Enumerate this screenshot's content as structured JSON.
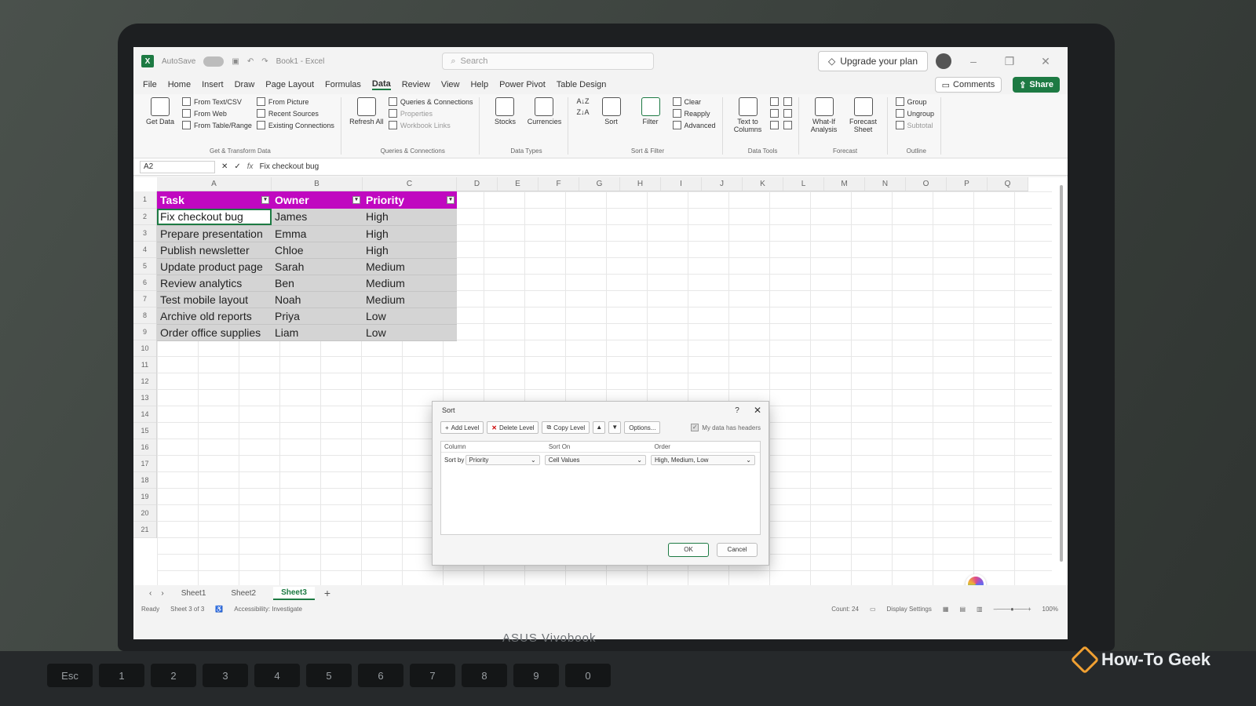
{
  "titlebar": {
    "autosave_label": "AutoSave",
    "doc_title": "Book1 - Excel",
    "search_placeholder": "Search",
    "upgrade_label": "Upgrade your plan"
  },
  "menu": {
    "items": [
      "File",
      "Home",
      "Insert",
      "Draw",
      "Page Layout",
      "Formulas",
      "Data",
      "Review",
      "View",
      "Help",
      "Power Pivot",
      "Table Design"
    ],
    "active": "Data",
    "comments_label": "Comments",
    "share_label": "Share"
  },
  "ribbon": {
    "get_data": "Get Data",
    "from_text_csv": "From Text/CSV",
    "from_web": "From Web",
    "from_table_range": "From Table/Range",
    "from_picture": "From Picture",
    "recent_sources": "Recent Sources",
    "existing_connections": "Existing Connections",
    "group_get_transform": "Get & Transform Data",
    "refresh_all": "Refresh All",
    "queries_connections": "Queries & Connections",
    "properties": "Properties",
    "workbook_links": "Workbook Links",
    "group_queries": "Queries & Connections",
    "stocks": "Stocks",
    "currencies": "Currencies",
    "group_data_types": "Data Types",
    "sort": "Sort",
    "filter": "Filter",
    "clear": "Clear",
    "reapply": "Reapply",
    "advanced": "Advanced",
    "group_sort_filter": "Sort & Filter",
    "text_to_columns": "Text to Columns",
    "group_data_tools": "Data Tools",
    "what_if": "What-If Analysis",
    "forecast_sheet": "Forecast Sheet",
    "group_forecast": "Forecast",
    "group": "Group",
    "ungroup": "Ungroup",
    "subtotal": "Subtotal",
    "group_outline": "Outline"
  },
  "formula_bar": {
    "name_box": "A2",
    "formula": "Fix checkout bug"
  },
  "columns": [
    "A",
    "B",
    "C",
    "D",
    "E",
    "F",
    "G",
    "H",
    "I",
    "J",
    "K",
    "L",
    "M",
    "N",
    "O",
    "P",
    "Q"
  ],
  "rows": [
    "1",
    "2",
    "3",
    "4",
    "5",
    "6",
    "7",
    "8",
    "9",
    "10",
    "11",
    "12",
    "13",
    "14",
    "15",
    "16",
    "17",
    "18",
    "19",
    "20",
    "21"
  ],
  "table": {
    "headers": [
      "Task",
      "Owner",
      "Priority"
    ],
    "rows": [
      [
        "Fix checkout bug",
        "James",
        "High"
      ],
      [
        "Prepare presentation",
        "Emma",
        "High"
      ],
      [
        "Publish newsletter",
        "Chloe",
        "High"
      ],
      [
        "Update product page",
        "Sarah",
        "Medium"
      ],
      [
        "Review analytics",
        "Ben",
        "Medium"
      ],
      [
        "Test mobile layout",
        "Noah",
        "Medium"
      ],
      [
        "Archive old reports",
        "Priya",
        "Low"
      ],
      [
        "Order office supplies",
        "Liam",
        "Low"
      ]
    ]
  },
  "sheet_tabs": [
    "Sheet1",
    "Sheet2",
    "Sheet3"
  ],
  "active_sheet": "Sheet3",
  "status": {
    "ready": "Ready",
    "sheet_of": "Sheet 3 of 3",
    "accessibility": "Accessibility: Investigate",
    "count": "Count: 24",
    "display_settings": "Display Settings",
    "zoom": "100%"
  },
  "dialog": {
    "title": "Sort",
    "help": "?",
    "add_level": "Add Level",
    "delete_level": "Delete Level",
    "copy_level": "Copy Level",
    "options": "Options...",
    "my_data_has_headers": "My data has headers",
    "col_column": "Column",
    "col_sort_on": "Sort On",
    "col_order": "Order",
    "sort_by_label": "Sort by",
    "sort_by_value": "Priority",
    "sort_on_value": "Cell Values",
    "order_value": "High, Medium, Low",
    "ok": "OK",
    "cancel": "Cancel"
  },
  "device": {
    "brand": "ASUS Vivobook",
    "watermark": "How-To Geek",
    "keys": [
      "Esc",
      "1",
      "2",
      "3",
      "4",
      "5",
      "6",
      "7",
      "8",
      "9",
      "0"
    ]
  },
  "colors": {
    "accent": "#1d7a43",
    "table_header": "#c008c0"
  }
}
